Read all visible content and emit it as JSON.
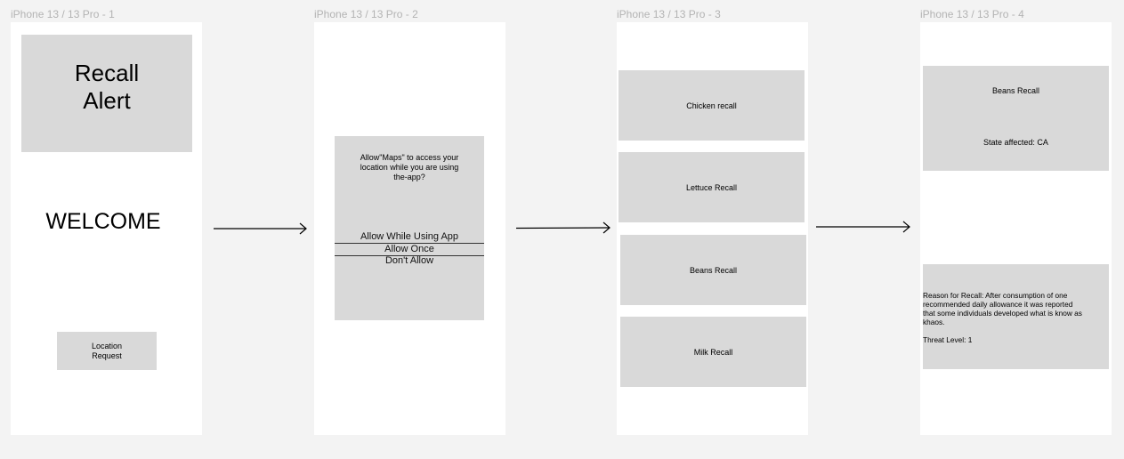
{
  "frames": [
    {
      "title": "iPhone 13 / 13 Pro - 1",
      "hero_line1": "Recall",
      "hero_line2": "Alert",
      "welcome": "WELCOME",
      "button_line1": "Location",
      "button_line2": "Request"
    },
    {
      "title": "iPhone 13 / 13 Pro - 2",
      "dialog_text_line1": "Allow\"Maps\" to access your",
      "dialog_text_line2": "location while you are using",
      "dialog_text_line3": "the-app?",
      "options": [
        "Allow While Using App",
        "Allow Once",
        "Don't Allow"
      ]
    },
    {
      "title": "iPhone 13 / 13 Pro - 3",
      "items": [
        "Chicken recall",
        "Lettuce Recall",
        "Beans Recall",
        "Milk Recall"
      ]
    },
    {
      "title": "iPhone 13 / 13 Pro - 4",
      "card_title": "Beans Recall",
      "state": "State affected: CA",
      "reason_line1": "Reason for Recall: After consumption of one",
      "reason_line2": "recommended daily allowance it was reported",
      "reason_line3": "that some individuals developed what is know as",
      "reason_line4": "khaos.",
      "threat": "Threat Level: 1"
    }
  ],
  "colors": {
    "canvas": "#f3f3f3",
    "frame": "#ffffff",
    "placeholder": "#d9d9d9",
    "label": "#b3b3b3"
  }
}
